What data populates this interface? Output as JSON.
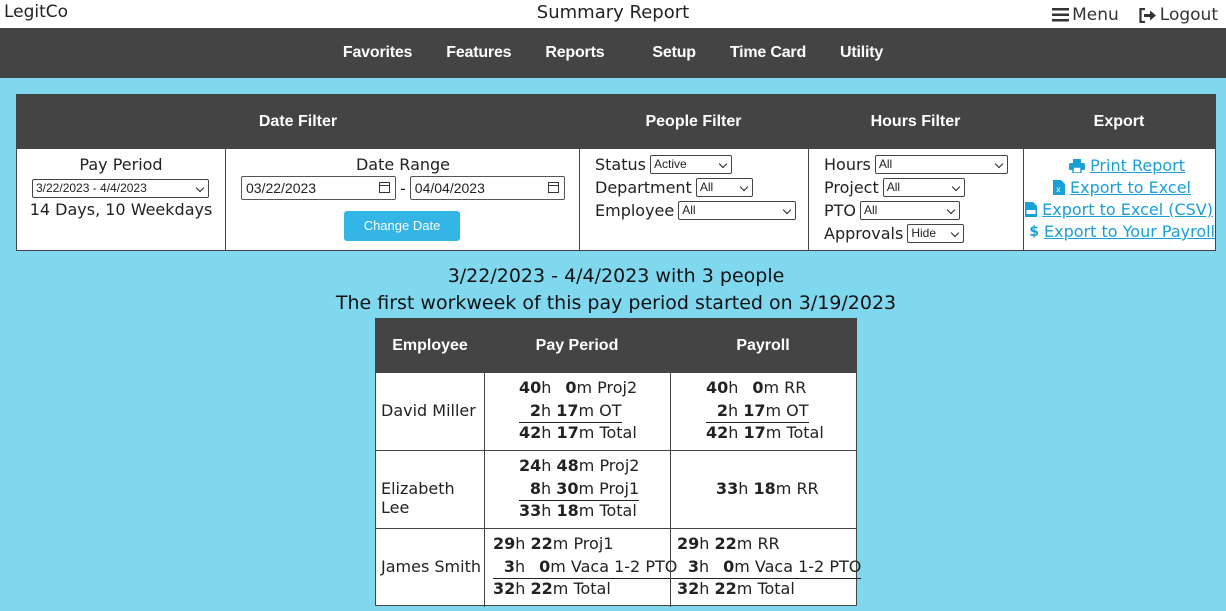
{
  "app": {
    "brand": "LegitCo",
    "title": "Summary Report",
    "menu": "Menu",
    "logout": "Logout"
  },
  "nav": [
    "Favorites",
    "Features",
    "Reports",
    "Setup",
    "Time Card",
    "Utility"
  ],
  "filters": {
    "headers": {
      "date": "Date Filter",
      "people": "People Filter",
      "hours": "Hours Filter",
      "export": "Export"
    },
    "pay_period_label": "Pay Period",
    "pay_period_value": "3/22/2023 - 4/4/2023",
    "pay_period_info": "14 Days, 10 Weekdays",
    "date_range_label": "Date Range",
    "date_from": "03/22/2023",
    "date_sep": "-",
    "date_to": "04/04/2023",
    "change_date": "Change Date",
    "status_label": "Status",
    "status_value": "Active",
    "department_label": "Department",
    "department_value": "All",
    "employee_label": "Employee",
    "employee_value": "All",
    "hours_label": "Hours",
    "hours_value": "All",
    "project_label": "Project",
    "project_value": "All",
    "pto_label": "PTO",
    "pto_value": "All",
    "approvals_label": "Approvals",
    "approvals_value": "Hide",
    "export_links": [
      "Print Report",
      "Export to Excel",
      "Export to Excel (CSV)",
      "Export to Your Payroll"
    ]
  },
  "summary": {
    "line1": "3/22/2023 - 4/4/2023 with 3 people",
    "line2": "The first workweek of this pay period started on 3/19/2023"
  },
  "report": {
    "headers": [
      "Employee",
      "Pay Period",
      "Payroll"
    ],
    "rows": [
      {
        "name": "David Miller",
        "pay_period": [
          {
            "h": "40",
            "m": "0",
            "label": "Proj2"
          },
          {
            "h": "2",
            "m": "17",
            "label": "OT"
          },
          {
            "h": "42",
            "m": "17",
            "label": "Total"
          }
        ],
        "payroll": [
          {
            "h": "40",
            "m": "0",
            "label": "RR"
          },
          {
            "h": "2",
            "m": "17",
            "label": "OT"
          },
          {
            "h": "42",
            "m": "17",
            "label": "Total"
          }
        ]
      },
      {
        "name": "Elizabeth Lee",
        "pay_period": [
          {
            "h": "24",
            "m": "48",
            "label": "Proj2"
          },
          {
            "h": "8",
            "m": "30",
            "label": "Proj1"
          },
          {
            "h": "33",
            "m": "18",
            "label": "Total"
          }
        ],
        "payroll": [
          {
            "h": "33",
            "m": "18",
            "label": "RR"
          }
        ]
      },
      {
        "name": "James Smith",
        "pay_period": [
          {
            "h": "29",
            "m": "22",
            "label": "Proj1"
          },
          {
            "h": "3",
            "m": "0",
            "label": "Vaca 1-2 PTO"
          },
          {
            "h": "32",
            "m": "22",
            "label": "Total"
          }
        ],
        "payroll": [
          {
            "h": "29",
            "m": "22",
            "label": "RR"
          },
          {
            "h": "3",
            "m": "0",
            "label": "Vaca 1-2 PTO"
          },
          {
            "h": "32",
            "m": "22",
            "label": "Total"
          }
        ]
      }
    ]
  },
  "colors": {
    "page_bg": "#80d8ee",
    "header_bg": "#444444",
    "link": "#1a9fd6",
    "button": "#33b5e5"
  }
}
